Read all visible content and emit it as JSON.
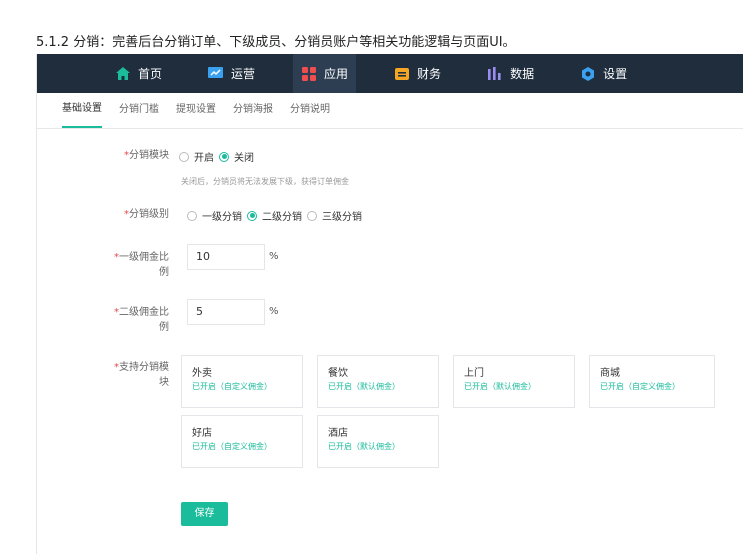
{
  "doc_heading": "5.1.2 分销：完善后台分销订单、下级成员、分销员账户等相关功能逻辑与页面UI。",
  "nav": {
    "items": [
      {
        "label": "首页",
        "icon": "home-icon"
      },
      {
        "label": "运营",
        "icon": "monitor-icon"
      },
      {
        "label": "应用",
        "icon": "apps-grid-icon"
      },
      {
        "label": "财务",
        "icon": "wallet-icon"
      },
      {
        "label": "数据",
        "icon": "bar-chart-icon"
      },
      {
        "label": "设置",
        "icon": "gear-icon"
      }
    ],
    "active": "应用"
  },
  "subtabs": [
    "基础设置",
    "分销门槛",
    "提现设置",
    "分销海报",
    "分销说明"
  ],
  "form": {
    "module": {
      "required_mark": "*",
      "label": "分销模块",
      "options": [
        "开启",
        "关闭"
      ],
      "selected": "关闭",
      "hint": "关闭后，分销员将无法发展下级，获得订单佣金"
    },
    "level": {
      "required_mark": "*",
      "label": "分销级别",
      "options": [
        "一级分销",
        "二级分销",
        "三级分销"
      ],
      "selected": "二级分销"
    },
    "first_rate": {
      "required_mark": "*",
      "label_line1": "一级佣金比",
      "label_line2": "例",
      "value": "10",
      "unit": "%"
    },
    "second_rate": {
      "required_mark": "*",
      "label_line1": "二级佣金比",
      "label_line2": "例",
      "value": "5",
      "unit": "%"
    },
    "modules": {
      "required_mark": "*",
      "label_line1": "支持分销模",
      "label_line2": "块",
      "cards": [
        {
          "name": "外卖",
          "status": "已开启（自定义佣金）"
        },
        {
          "name": "餐饮",
          "status": "已开启（默认佣金）"
        },
        {
          "name": "上门",
          "status": "已开启（默认佣金）"
        },
        {
          "name": "商城",
          "status": "已开启（自定义佣金）"
        },
        {
          "name": "好店",
          "status": "已开启（自定义佣金）"
        },
        {
          "name": "酒店",
          "status": "已开启（默认佣金）"
        }
      ]
    },
    "save_label": "保存"
  },
  "colors": {
    "nav_bg": "#1f2d3d",
    "accent": "#1bbc9b",
    "required": "#e24b4b"
  }
}
